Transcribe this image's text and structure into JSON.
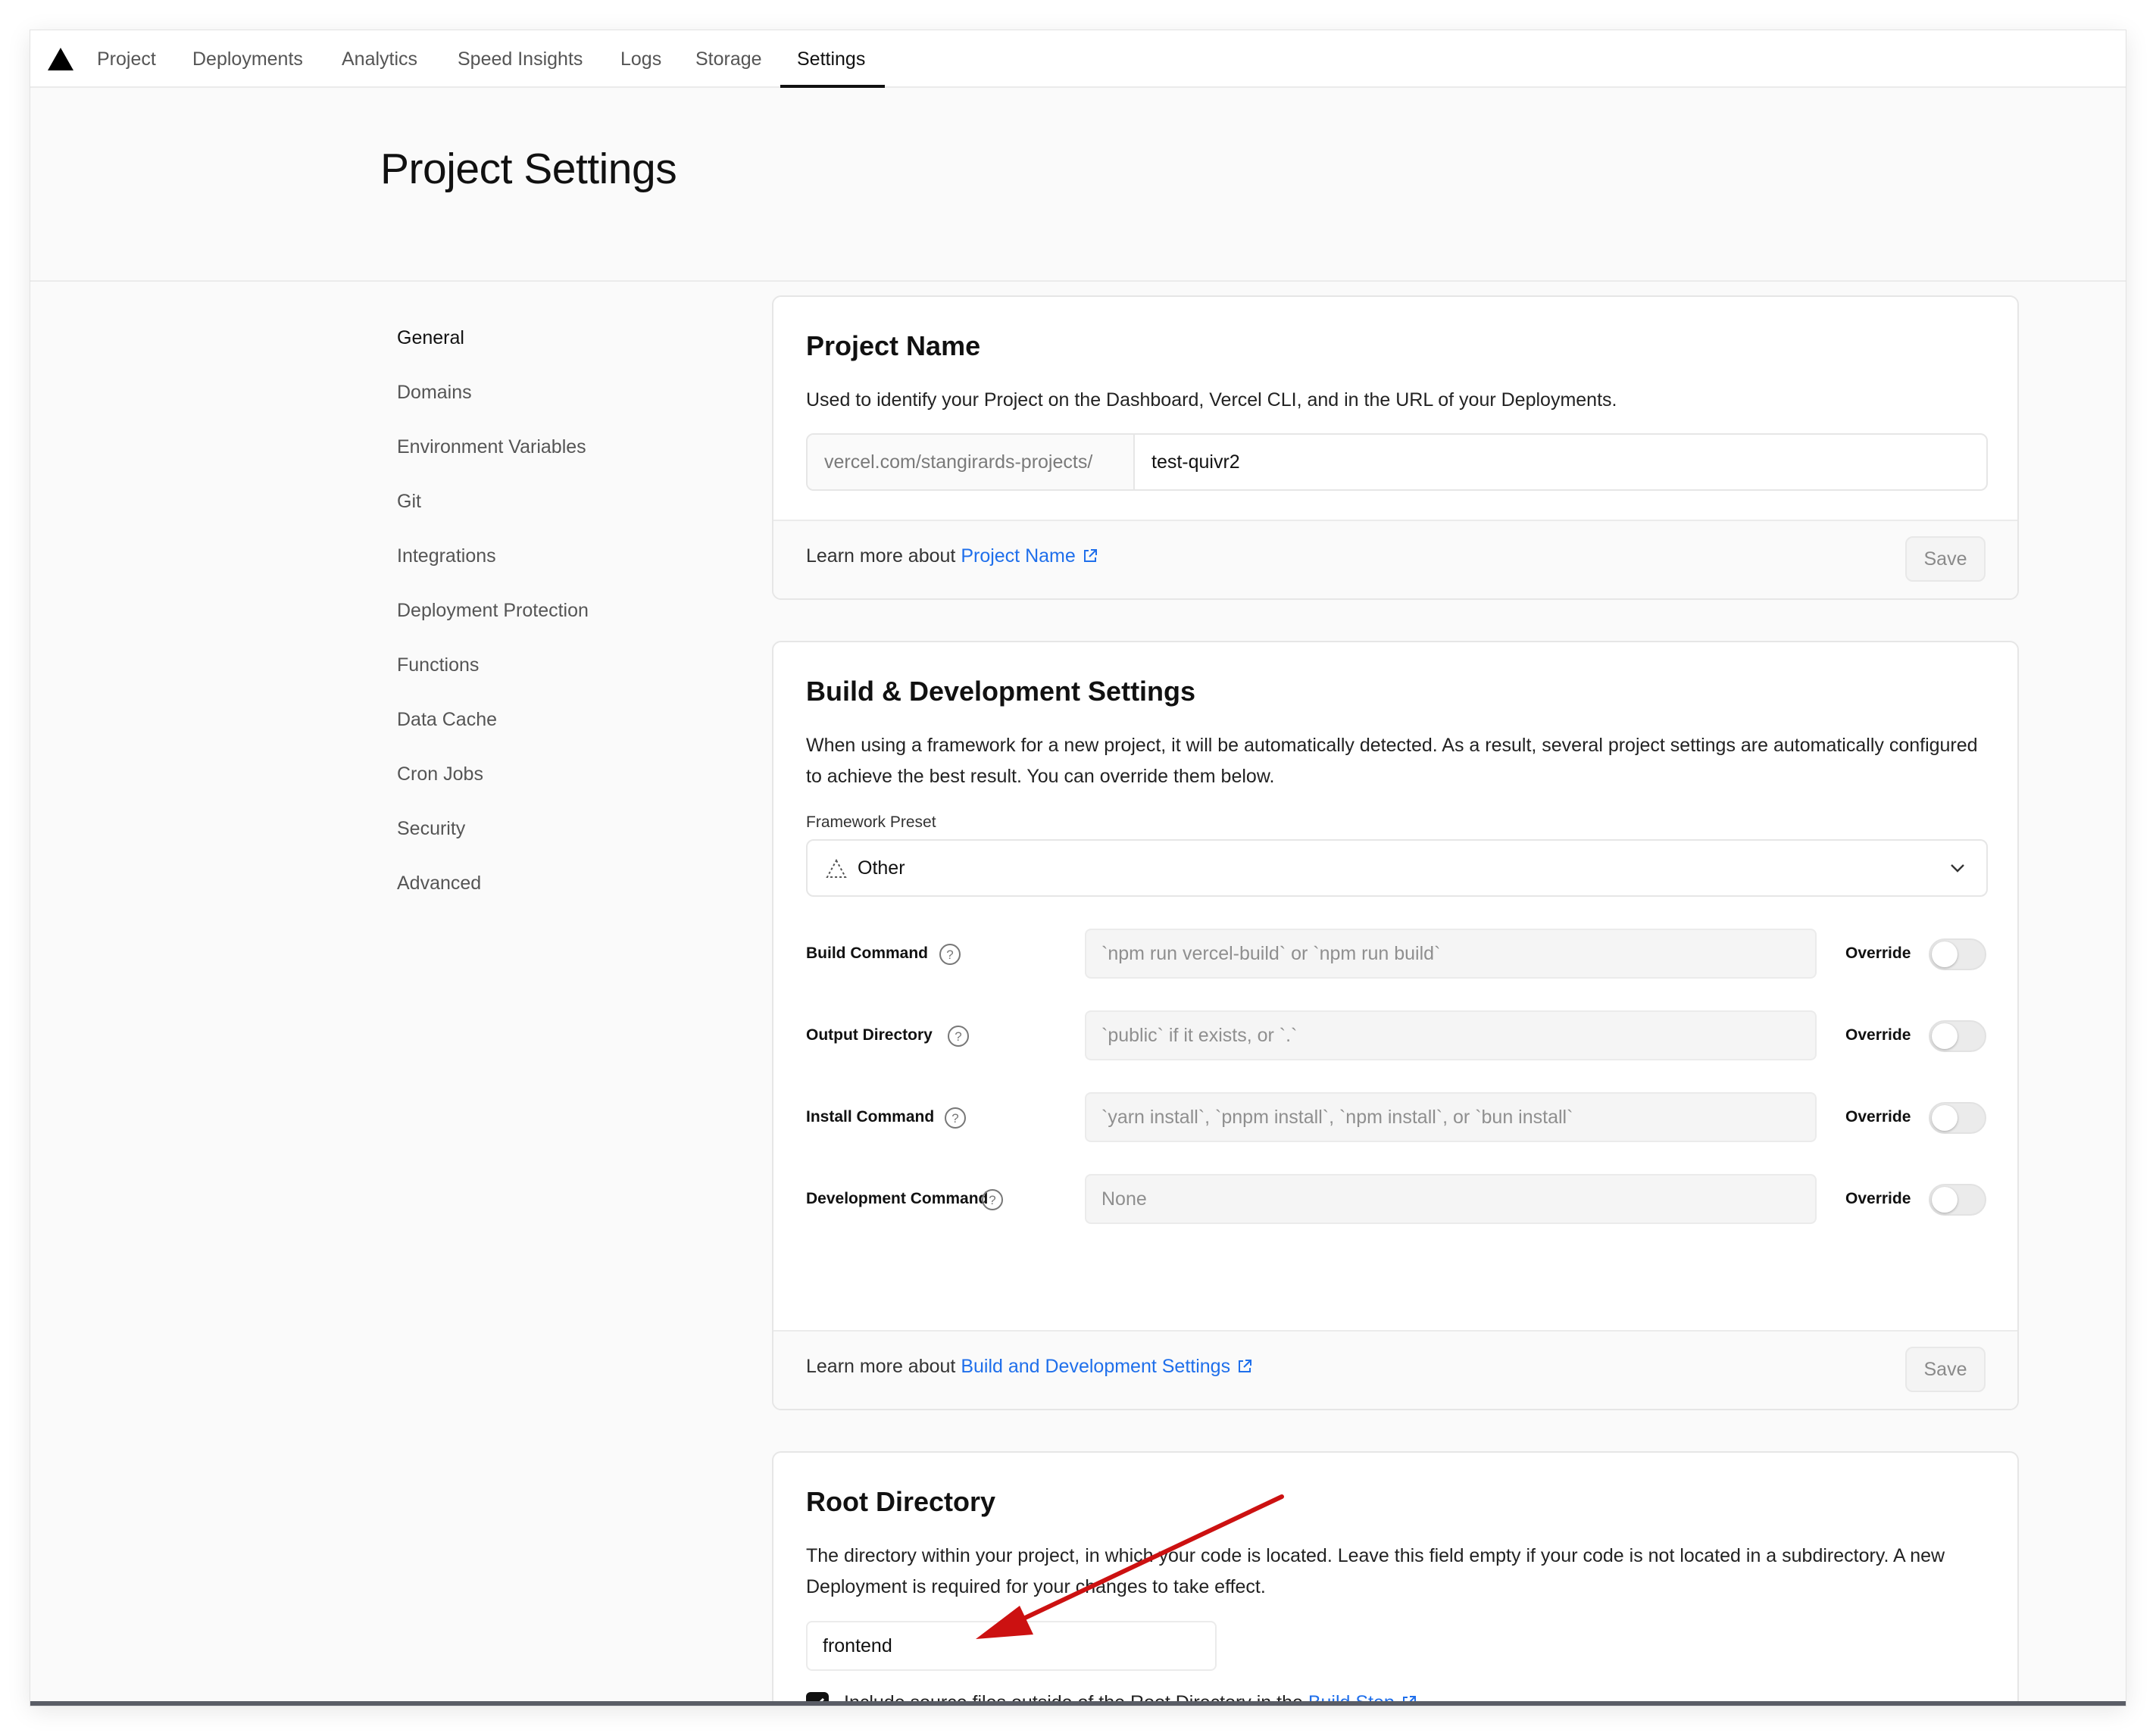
{
  "nav": {
    "items": [
      "Project",
      "Deployments",
      "Analytics",
      "Speed Insights",
      "Logs",
      "Storage",
      "Settings"
    ],
    "active": "Settings"
  },
  "header": {
    "title": "Project Settings"
  },
  "sidebar": {
    "items": [
      "General",
      "Domains",
      "Environment Variables",
      "Git",
      "Integrations",
      "Deployment Protection",
      "Functions",
      "Data Cache",
      "Cron Jobs",
      "Security",
      "Advanced"
    ],
    "active": "General"
  },
  "project_name": {
    "title": "Project Name",
    "description": "Used to identify your Project on the Dashboard, Vercel CLI, and in the URL of your Deployments.",
    "prefix": "vercel.com/stangirards-projects/",
    "value": "test-quivr2",
    "learn_more": "Learn more about",
    "learn_link": "Project Name",
    "save": "Save"
  },
  "build": {
    "title": "Build & Development Settings",
    "description": "When using a framework for a new project, it will be automatically detected. As a result, several project settings are automatically configured to achieve the best result. You can override them below.",
    "framework_label": "Framework Preset",
    "framework_value": "Other",
    "commands": [
      {
        "label": "Build Command",
        "placeholder": "`npm run vercel-build` or `npm run build`",
        "override": "Override"
      },
      {
        "label": "Output Directory",
        "placeholder": "`public` if it exists, or `.`",
        "override": "Override"
      },
      {
        "label": "Install Command",
        "placeholder": "`yarn install`, `pnpm install`, `npm install`, or `bun install`",
        "override": "Override"
      },
      {
        "label": "Development Command",
        "placeholder": "None",
        "override": "Override"
      }
    ],
    "learn_more": "Learn more about",
    "learn_link": "Build and Development Settings",
    "save": "Save"
  },
  "root": {
    "title": "Root Directory",
    "description": "The directory within your project, in which your code is located. Leave this field empty if your code is not located in a subdirectory. A new Deployment is required for your changes to take effect.",
    "value": "frontend",
    "checkbox_label": "Include source files outside of the Root Directory in the",
    "checkbox_link": "Build Step",
    "checkbox_suffix": ".",
    "checked": true
  },
  "colors": {
    "link": "#1f6feb",
    "annotation_arrow": "#cc1111"
  }
}
